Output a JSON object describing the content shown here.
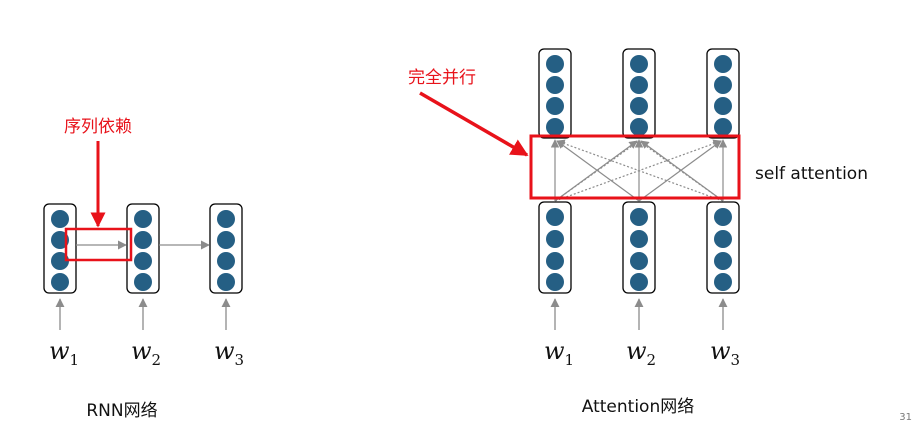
{
  "rnn": {
    "annotation": "序列依赖",
    "caption": "RNN网络",
    "words": [
      {
        "base": "w",
        "sub": "1"
      },
      {
        "base": "w",
        "sub": "2"
      },
      {
        "base": "w",
        "sub": "3"
      }
    ]
  },
  "attention": {
    "annotation": "完全并行",
    "layer_label": "self attention",
    "caption": "Attention网络",
    "words": [
      {
        "base": "w",
        "sub": "1"
      },
      {
        "base": "w",
        "sub": "2"
      },
      {
        "base": "w",
        "sub": "3"
      }
    ]
  },
  "page_number": "31",
  "colors": {
    "node": "#255f84",
    "highlight": "#e8121a",
    "arrow": "#8c8c8c",
    "box_border": "#000000"
  }
}
